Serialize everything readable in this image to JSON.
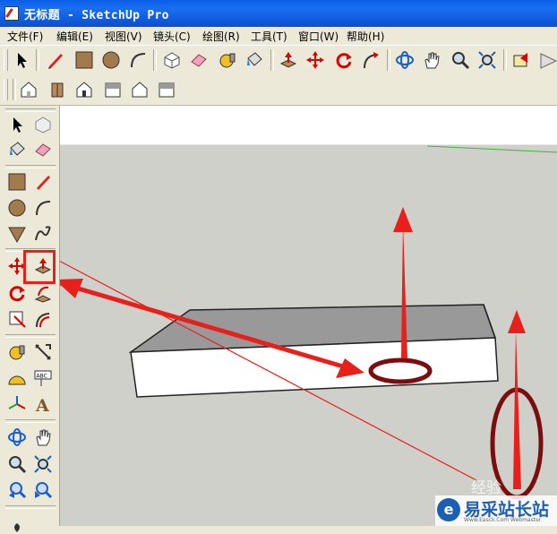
{
  "window": {
    "title": "无标题 - SketchUp Pro"
  },
  "menu": [
    {
      "label": "文件(F)"
    },
    {
      "label": "编辑(E)"
    },
    {
      "label": "视图(V)"
    },
    {
      "label": "镜头(C)"
    },
    {
      "label": "绘图(R)"
    },
    {
      "label": "工具(T)"
    },
    {
      "label": "窗口(W)"
    },
    {
      "label": "帮助(H)"
    }
  ],
  "toolbar_main": [
    "select-icon",
    "pencil-icon",
    "rectangle-icon",
    "circle-icon",
    "arc-icon",
    "make-component-icon",
    "eraser-icon",
    "tape-measure-icon",
    "paint-bucket-icon",
    "push-pull-icon",
    "move-icon",
    "rotate-icon",
    "follow-me-icon",
    "orbit-icon",
    "pan-icon",
    "zoom-icon",
    "zoom-extents-icon",
    "previous-view-icon",
    "next-view-icon"
  ],
  "toolbar_views": [
    "iso-view-icon",
    "top-view-icon",
    "front-view-icon",
    "right-view-icon",
    "back-view-icon",
    "left-view-icon"
  ],
  "left_toolbar": [
    "select-icon",
    "make-component-icon",
    "paint-bucket-icon",
    "eraser-icon",
    "rectangle-icon",
    "line-icon",
    "circle-icon",
    "arc-icon",
    "polygon-icon",
    "freehand-icon",
    "move-icon",
    "push-pull-icon",
    "rotate-icon",
    "follow-me-icon",
    "scale-icon",
    "offset-icon",
    "tape-measure-icon",
    "dimension-icon",
    "protractor-icon",
    "text-icon",
    "axes-icon",
    "3d-text-icon",
    "orbit-icon",
    "pan-icon",
    "zoom-icon",
    "zoom-window-icon",
    "previous-icon",
    "zoom-extents-icon"
  ],
  "highlighted_tool": "push-pull-icon",
  "watermark": {
    "badge": "经验",
    "site": "易采站长站",
    "site_small": "Www.Easck.Com  Webmaster"
  }
}
